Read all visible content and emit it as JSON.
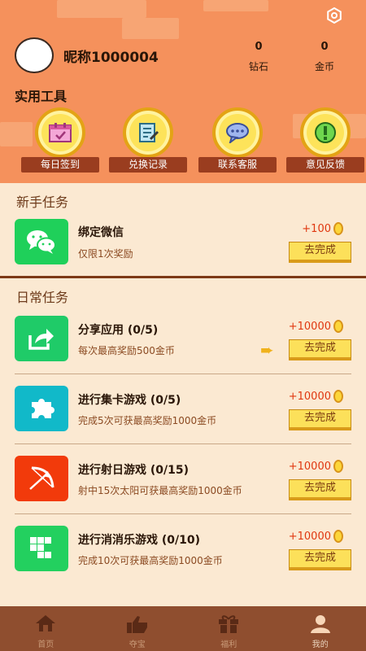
{
  "profile": {
    "nickname": "昵称1000004",
    "stats": [
      {
        "value": "0",
        "label": "钻石"
      },
      {
        "value": "0",
        "label": "金币"
      }
    ]
  },
  "tools": {
    "title": "实用工具",
    "items": [
      {
        "label": "每日签到",
        "icon": "calendar-icon"
      },
      {
        "label": "兑换记录",
        "icon": "record-icon"
      },
      {
        "label": "联系客服",
        "icon": "chat-icon"
      },
      {
        "label": "意见反馈",
        "icon": "exclaim-icon"
      }
    ]
  },
  "newbie": {
    "title": "新手任务",
    "tasks": [
      {
        "title": "绑定微信",
        "sub": "仅限1次奖励",
        "reward": "+100",
        "button": "去完成",
        "icon": "wechat-icon",
        "color": "#1fd05a"
      }
    ]
  },
  "daily": {
    "title": "日常任务",
    "tasks": [
      {
        "title": "分享应用 (0/5)",
        "sub": "每次最高奖励500金币",
        "reward": "+10000",
        "button": "去完成",
        "icon": "share-icon",
        "color": "#1fcb68"
      },
      {
        "title": "进行集卡游戏 (0/5)",
        "sub": "完成5次可获最高奖励1000金币",
        "reward": "+10000",
        "button": "去完成",
        "icon": "puzzle-icon",
        "color": "#11b9c9"
      },
      {
        "title": "进行射日游戏 (0/15)",
        "sub": "射中15次太阳可获最高奖励1000金币",
        "reward": "+10000",
        "button": "去完成",
        "icon": "bow-icon",
        "color": "#f23a0b"
      },
      {
        "title": "进行消消乐游戏 (0/10)",
        "sub": "完成10次可获最高奖励1000金币",
        "reward": "+10000",
        "button": "去完成",
        "icon": "blocks-icon",
        "color": "#23d05f"
      }
    ]
  },
  "nav": [
    {
      "label": "首页",
      "icon": "home-icon"
    },
    {
      "label": "夺宝",
      "icon": "thumbs-up-icon"
    },
    {
      "label": "福利",
      "icon": "gift-icon"
    },
    {
      "label": "我的",
      "icon": "user-icon"
    }
  ]
}
